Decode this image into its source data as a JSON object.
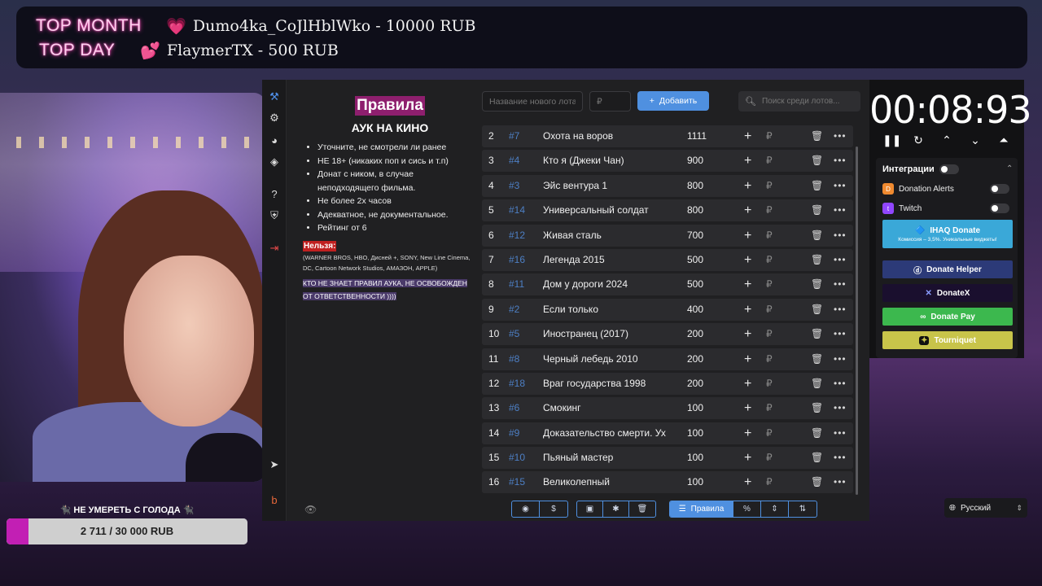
{
  "banner": {
    "month_label": "TOP MONTH",
    "month_value": "Dumo4ka_CoJlHblWko - 10000 RUB",
    "day_label": "TOP DAY",
    "day_value": "FlaymerTX - 500 RUB"
  },
  "goal": {
    "title": "🐈‍⬛ НЕ УМЕРЕТЬ С ГОЛОДА 🐈‍⬛",
    "text": "2 711 / 30 000 RUB",
    "progress": 0.09
  },
  "sidebar": {
    "icons": [
      "hammer-icon",
      "gear-icon",
      "pie-chart-icon",
      "layers-icon",
      "help-icon",
      "shield-icon",
      "logout-icon",
      "telegram-icon",
      "boosty-icon"
    ]
  },
  "rules": {
    "title": "Правила",
    "subtitle": "АУК НА КИНО",
    "items": [
      "Уточните, не смотрели ли ранее",
      "НЕ 18+ (никаких поп и сись и т.п)",
      "Донат с ником, в случае неподходящего фильма.",
      "Не более 2х часов",
      "Адекватное, не документальное.",
      "Рейтинг от 6"
    ],
    "forbidden_label": "Нельзя:",
    "forbidden_text": "(WARNER BROS, HBO, Дисней +, SONY, New Line Cinema, DC, Cartoon Network Studios, АМАЗОН, APPLE)",
    "warning": "КТО НЕ ЗНАЕТ ПРАВИЛ АУКА, НЕ ОСВОБОЖДЕН ОТ ОТВЕТСТВЕННОСТИ ))))"
  },
  "toolbar": {
    "lot_name_placeholder": "Название нового лота",
    "price_placeholder": "₽",
    "add_label": "Добавить",
    "search_placeholder": "Поиск среди лотов..."
  },
  "lots": [
    {
      "pos": "2",
      "id": "#7",
      "name": "Охота на воров",
      "amount": "1111"
    },
    {
      "pos": "3",
      "id": "#4",
      "name": "Кто я (Джеки Чан)",
      "amount": "900"
    },
    {
      "pos": "4",
      "id": "#3",
      "name": "Эйс вентура 1",
      "amount": "800"
    },
    {
      "pos": "5",
      "id": "#14",
      "name": "Универсальный солдат",
      "amount": "800"
    },
    {
      "pos": "6",
      "id": "#12",
      "name": "Живая сталь",
      "amount": "700"
    },
    {
      "pos": "7",
      "id": "#16",
      "name": "Легенда 2015",
      "amount": "500"
    },
    {
      "pos": "8",
      "id": "#11",
      "name": "Дом у дороги 2024",
      "amount": "500"
    },
    {
      "pos": "9",
      "id": "#2",
      "name": "Если только",
      "amount": "400"
    },
    {
      "pos": "10",
      "id": "#5",
      "name": "Иностранец (2017)",
      "amount": "200"
    },
    {
      "pos": "11",
      "id": "#8",
      "name": "Черный лебедь 2010",
      "amount": "200"
    },
    {
      "pos": "12",
      "id": "#18",
      "name": " Враг государства 1998",
      "amount": "200"
    },
    {
      "pos": "13",
      "id": "#6",
      "name": "Смокинг",
      "amount": "100"
    },
    {
      "pos": "14",
      "id": "#9",
      "name": "Доказательство смерти. Ух",
      "amount": "100"
    },
    {
      "pos": "15",
      "id": "#10",
      "name": "Пьяный мастер",
      "amount": "100"
    },
    {
      "pos": "16",
      "id": "#15",
      "name": "Великолепный",
      "amount": "100"
    }
  ],
  "lot_currency": "₽",
  "bottom_toolbar": {
    "rules_label": "Правила"
  },
  "timer": {
    "value": "00:08:93"
  },
  "integrations": {
    "title": "Интеграции",
    "donation_alerts": "Donation Alerts",
    "twitch": "Twitch",
    "ihaq_title": "IHAQ Donate",
    "ihaq_sub": "Комиссия – 3,5%. Уникальные виджеты!",
    "donate_helper": "Donate Helper",
    "donatex": "DonateX",
    "donate_pay": "Donate Pay",
    "tourniquet": "Tourniquet"
  },
  "language": "Русский",
  "colors": {
    "accent": "#4f90e0",
    "lot_id": "#4d7fc4",
    "ihaq": "#3aa8d8",
    "donate_helper": "#2c3a78",
    "donatex": "#1a0f2e",
    "donate_pay": "#3cb84e",
    "tourniquet": "#c8c44a",
    "goal_fill": "#c21fb4"
  }
}
